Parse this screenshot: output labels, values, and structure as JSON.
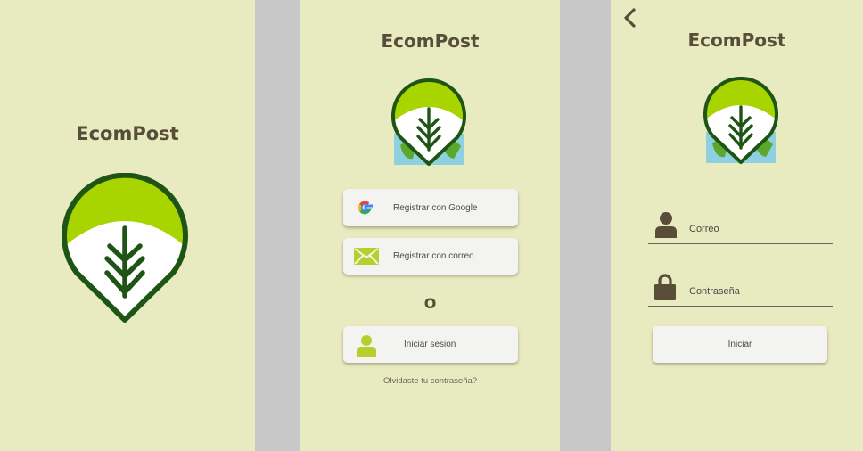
{
  "app": {
    "title": "EcomPost"
  },
  "colors": {
    "background": "#e8eabf",
    "accent": "#a8d400",
    "dark_green": "#1e5414",
    "brown": "#574d38",
    "button": "#f3f3f1"
  },
  "splash": {
    "title": "EcomPost"
  },
  "welcome": {
    "title": "EcomPost",
    "google_button": {
      "label": "Registrar con Google",
      "icon": "google-icon"
    },
    "email_button": {
      "label": "Registrar con correo",
      "icon": "envelope-icon"
    },
    "or_text": "O",
    "login_button": {
      "label": "Iniciar sesion",
      "icon": "user-icon"
    },
    "forgot_link": "Olvidaste tu contraseña?"
  },
  "login": {
    "title": "EcomPost",
    "back_icon": "chevron-left-icon",
    "email_field": {
      "label": "Correo",
      "icon": "person-icon"
    },
    "password_field": {
      "label": "Contraseña",
      "icon": "lock-icon"
    },
    "submit_button": {
      "label": "Iniciar"
    }
  }
}
